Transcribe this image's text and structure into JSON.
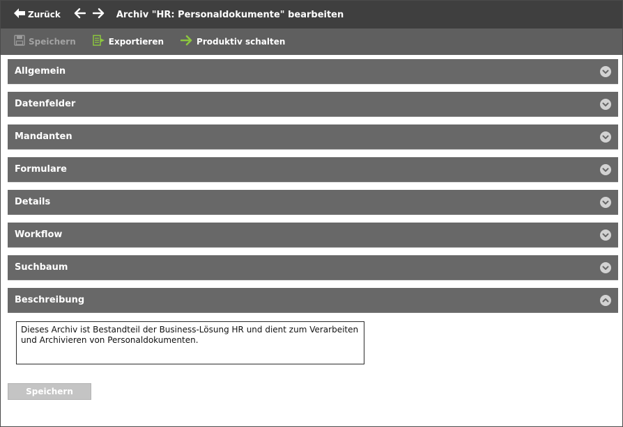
{
  "header": {
    "back_label": "Zurück",
    "title": "Archiv \"HR: Personaldokumente\" bearbeiten"
  },
  "toolbar": {
    "save_label": "Speichern",
    "export_label": "Exportieren",
    "productive_label": "Produktiv schalten"
  },
  "sections": [
    {
      "label": "Allgemein",
      "state": "collapsed"
    },
    {
      "label": "Datenfelder",
      "state": "collapsed"
    },
    {
      "label": "Mandanten",
      "state": "collapsed"
    },
    {
      "label": "Formulare",
      "state": "collapsed"
    },
    {
      "label": "Details",
      "state": "collapsed"
    },
    {
      "label": "Workflow",
      "state": "collapsed"
    },
    {
      "label": "Suchbaum",
      "state": "collapsed"
    },
    {
      "label": "Beschreibung",
      "state": "expanded"
    }
  ],
  "description": {
    "text": "Dieses Archiv ist Bestandteil der Business-Lösung HR und dient zum Verarbeiten und Archivieren von Personaldokumenten."
  },
  "footer": {
    "save_label": "Speichern"
  },
  "colors": {
    "titlebar": "#3f3f3f",
    "toolbar": "#5f5f5f",
    "section_header": "#686868",
    "accent_green": "#8cc63f"
  }
}
